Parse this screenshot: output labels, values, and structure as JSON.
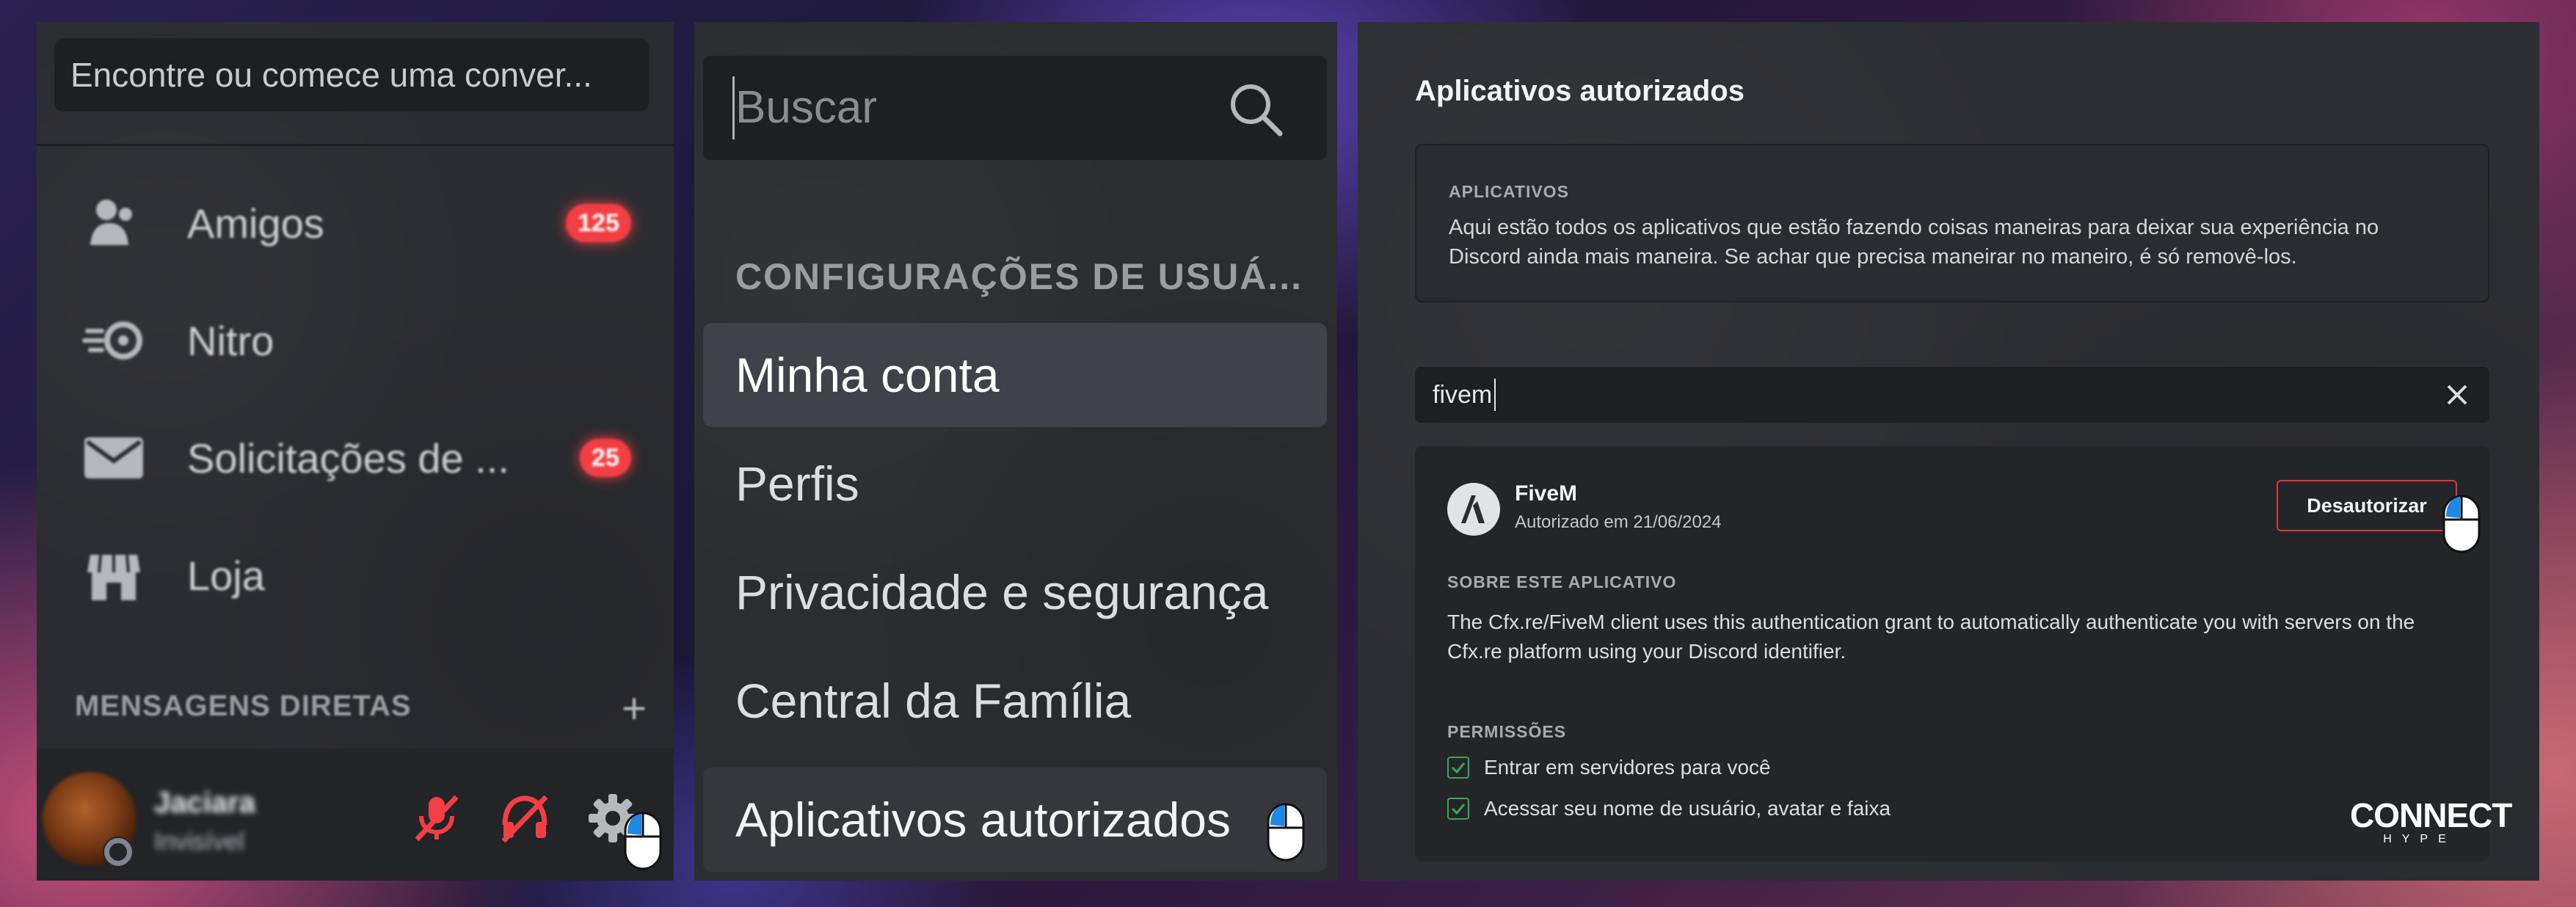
{
  "colors": {
    "badge": "#f23f43",
    "danger": "#da373c",
    "check": "#3ba55c",
    "selected_bg": "#404249",
    "input_bg": "#1e1f22"
  },
  "panel1": {
    "search": {
      "placeholder": "Encontre ou comece uma conver..."
    },
    "nav": [
      {
        "label": "Amigos",
        "icon": "friends-icon",
        "badge": "125"
      },
      {
        "label": "Nitro",
        "icon": "nitro-icon"
      },
      {
        "label": "Solicitações de ...",
        "icon": "message-requests-icon",
        "badge": "25"
      },
      {
        "label": "Loja",
        "icon": "shop-icon"
      }
    ],
    "dm_header": {
      "label": "MENSAGENS DIRETAS",
      "add_icon": "plus-icon"
    },
    "user": {
      "name": "Jaciara",
      "status": "Invisível",
      "icons": [
        "mic-muted-icon",
        "headset-muted-icon",
        "gear-icon"
      ]
    }
  },
  "panel2": {
    "search": {
      "placeholder": "Buscar",
      "icon": "search-icon"
    },
    "section_title": "CONFIGURAÇÕES DE USUÁ...",
    "menu": [
      {
        "label": "Minha conta",
        "state": "selected"
      },
      {
        "label": "Perfis"
      },
      {
        "label": "Privacidade e segurança"
      },
      {
        "label": "Central da Família"
      },
      {
        "label": "Aplicativos autorizados",
        "state": "hover"
      }
    ]
  },
  "panel3": {
    "title": "Aplicativos autorizados",
    "info": {
      "label": "APLICATIVOS",
      "description": "Aqui estão todos os aplicativos que estão fazendo coisas maneiras para deixar sua experiência no Discord ainda mais maneira. Se achar que precisa maneirar no maneiro, é só removê-los."
    },
    "filter": {
      "value": "fivem",
      "clear_icon": "close-icon"
    },
    "app": {
      "name": "FiveM",
      "authorized_on": "Autorizado em 21/06/2024",
      "deauthorize_label": "Desautorizar",
      "about_label": "SOBRE ESTE APLICATIVO",
      "about_text": "The Cfx.re/FiveM client uses this authentication grant to automatically authenticate you with servers on the Cfx.re platform using your Discord identifier.",
      "permissions_label": "PERMISSÕES",
      "permissions": [
        "Entrar em servidores para você",
        "Acessar seu nome de usuário, avatar e faixa"
      ]
    },
    "brand": {
      "main": "CONNECT",
      "sub": "HYPE"
    }
  }
}
